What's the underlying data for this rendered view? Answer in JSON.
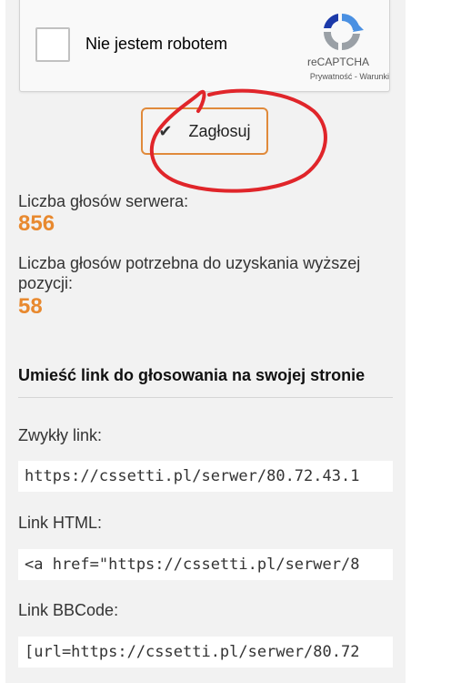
{
  "recaptcha": {
    "checkbox_label": "Nie jestem robotem",
    "brand": "reCAPTCHA",
    "links": "Prywatność - Warunki"
  },
  "vote": {
    "button_label": "Zagłosuj",
    "check_icon": "check-icon"
  },
  "stats": {
    "server_votes_label": "Liczba głosów serwera:",
    "server_votes_value": "856",
    "needed_votes_label_line1": "Liczba głosów potrzebna do uzyskania wyższej",
    "needed_votes_label_line2": "pozycji:",
    "needed_votes_value": "58"
  },
  "links_section": {
    "title": "Umieść link do głosowania na swojej stronie",
    "plain_label": "Zwykły link:",
    "plain_value": "https://cssetti.pl/serwer/80.72.43.1",
    "html_label": "Link HTML:",
    "html_value": "<a href=\"https://cssetti.pl/serwer/8",
    "bbcode_label": "Link BBCode:",
    "bbcode_value": "[url=https://cssetti.pl/serwer/80.72"
  },
  "colors": {
    "accent_orange": "#e8892f",
    "scribble_red": "#e0252a"
  }
}
